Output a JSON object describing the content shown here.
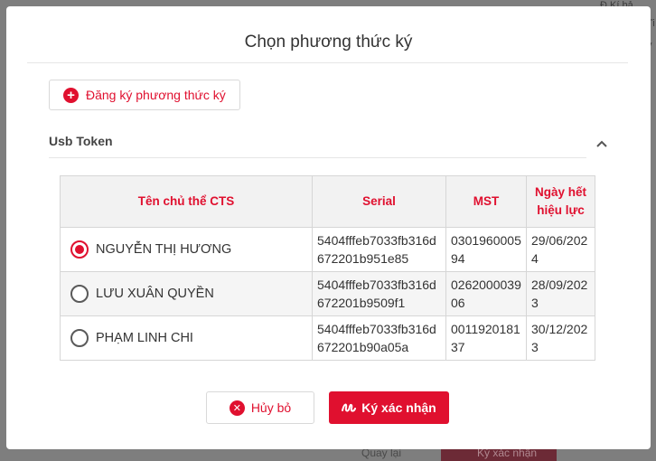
{
  "background": {
    "fragments": [
      "Đ Kí bả",
      "Ti",
      "y"
    ],
    "back_label": "Quay lại",
    "confirm_label": "Ký xác nhận"
  },
  "modal": {
    "title": "Chọn phương thức ký",
    "register_button": "Đăng ký phương thức ký",
    "section_title": "Usb Token",
    "table": {
      "headers": [
        "Tên chủ thể CTS",
        "Serial",
        "MST",
        "Ngày hết hiệu lực"
      ],
      "rows": [
        {
          "name": "NGUYỄN THỊ HƯƠNG",
          "serial_1": "5404fffeb7033fb316d",
          "serial_2": "672201b951e85",
          "mst_1": "0301960005",
          "mst_2": "94",
          "date_1": "29/06/202",
          "date_2": "4",
          "selected": true
        },
        {
          "name": "LƯU XUÂN QUYỀN",
          "serial_1": "5404fffeb7033fb316d",
          "serial_2": "672201b9509f1",
          "mst_1": "0262000039",
          "mst_2": "06",
          "date_1": "28/09/202",
          "date_2": "3",
          "selected": false
        },
        {
          "name": "PHẠM LINH CHI",
          "serial_1": "5404fffeb7033fb316d",
          "serial_2": "672201b90a05a",
          "mst_1": "0011920181",
          "mst_2": "37",
          "date_1": "30/12/202",
          "date_2": "3",
          "selected": false
        }
      ]
    },
    "cancel_button": "Hủy bỏ",
    "confirm_button": "Ký xác nhận",
    "accent_color": "#e0102f"
  },
  "icons": {
    "register": "plus-circle-icon",
    "collapse": "chevron-up-icon",
    "cancel": "x-circle-icon",
    "confirm": "signature-icon"
  }
}
